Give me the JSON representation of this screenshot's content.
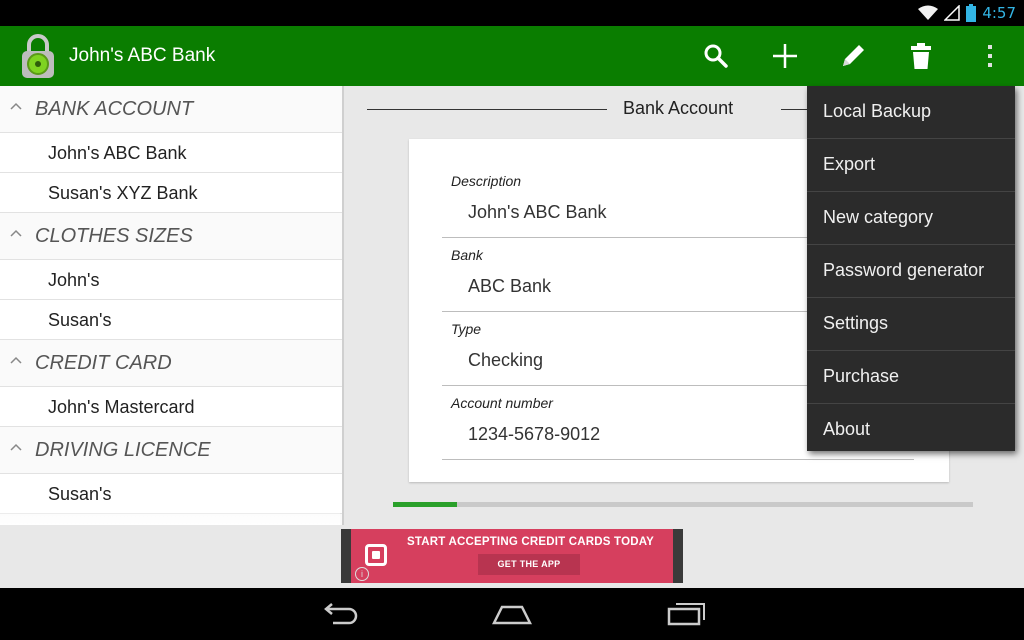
{
  "status": {
    "time": "4:57"
  },
  "app": {
    "title": "John's ABC Bank",
    "actions": [
      {
        "icon": "search-icon"
      },
      {
        "icon": "plus-icon"
      },
      {
        "icon": "pencil-icon"
      },
      {
        "icon": "trash-icon"
      },
      {
        "icon": "overflow-menu-icon"
      }
    ]
  },
  "sidebar": {
    "categories": [
      {
        "name": "BANK ACCOUNT",
        "items": [
          "John's ABC Bank",
          "Susan's XYZ Bank"
        ]
      },
      {
        "name": "CLOTHES SIZES",
        "items": [
          "John's",
          "Susan's"
        ]
      },
      {
        "name": "CREDIT CARD",
        "items": [
          "John's Mastercard"
        ]
      },
      {
        "name": "DRIVING LICENCE",
        "items": [
          "Susan's"
        ]
      }
    ]
  },
  "detail": {
    "section_title": "Bank Account",
    "fields": [
      {
        "label": "Description",
        "value": "John's ABC Bank"
      },
      {
        "label": "Bank",
        "value": "ABC Bank"
      },
      {
        "label": "Type",
        "value": "Checking"
      },
      {
        "label": "Account number",
        "value": "1234-5678-9012"
      }
    ],
    "progress": 0.11
  },
  "menu": {
    "items": [
      "Local Backup",
      "Export",
      "New category",
      "Password generator",
      "Settings",
      "Purchase",
      "About"
    ]
  },
  "ad": {
    "headline": "START ACCEPTING CREDIT CARDS TODAY",
    "cta": "GET THE APP",
    "info": "i"
  },
  "colors": {
    "appbar": "#0a7d00",
    "progress": "#2aa02a",
    "ad": "#d63f5e",
    "menu": "#2b2b2b"
  }
}
